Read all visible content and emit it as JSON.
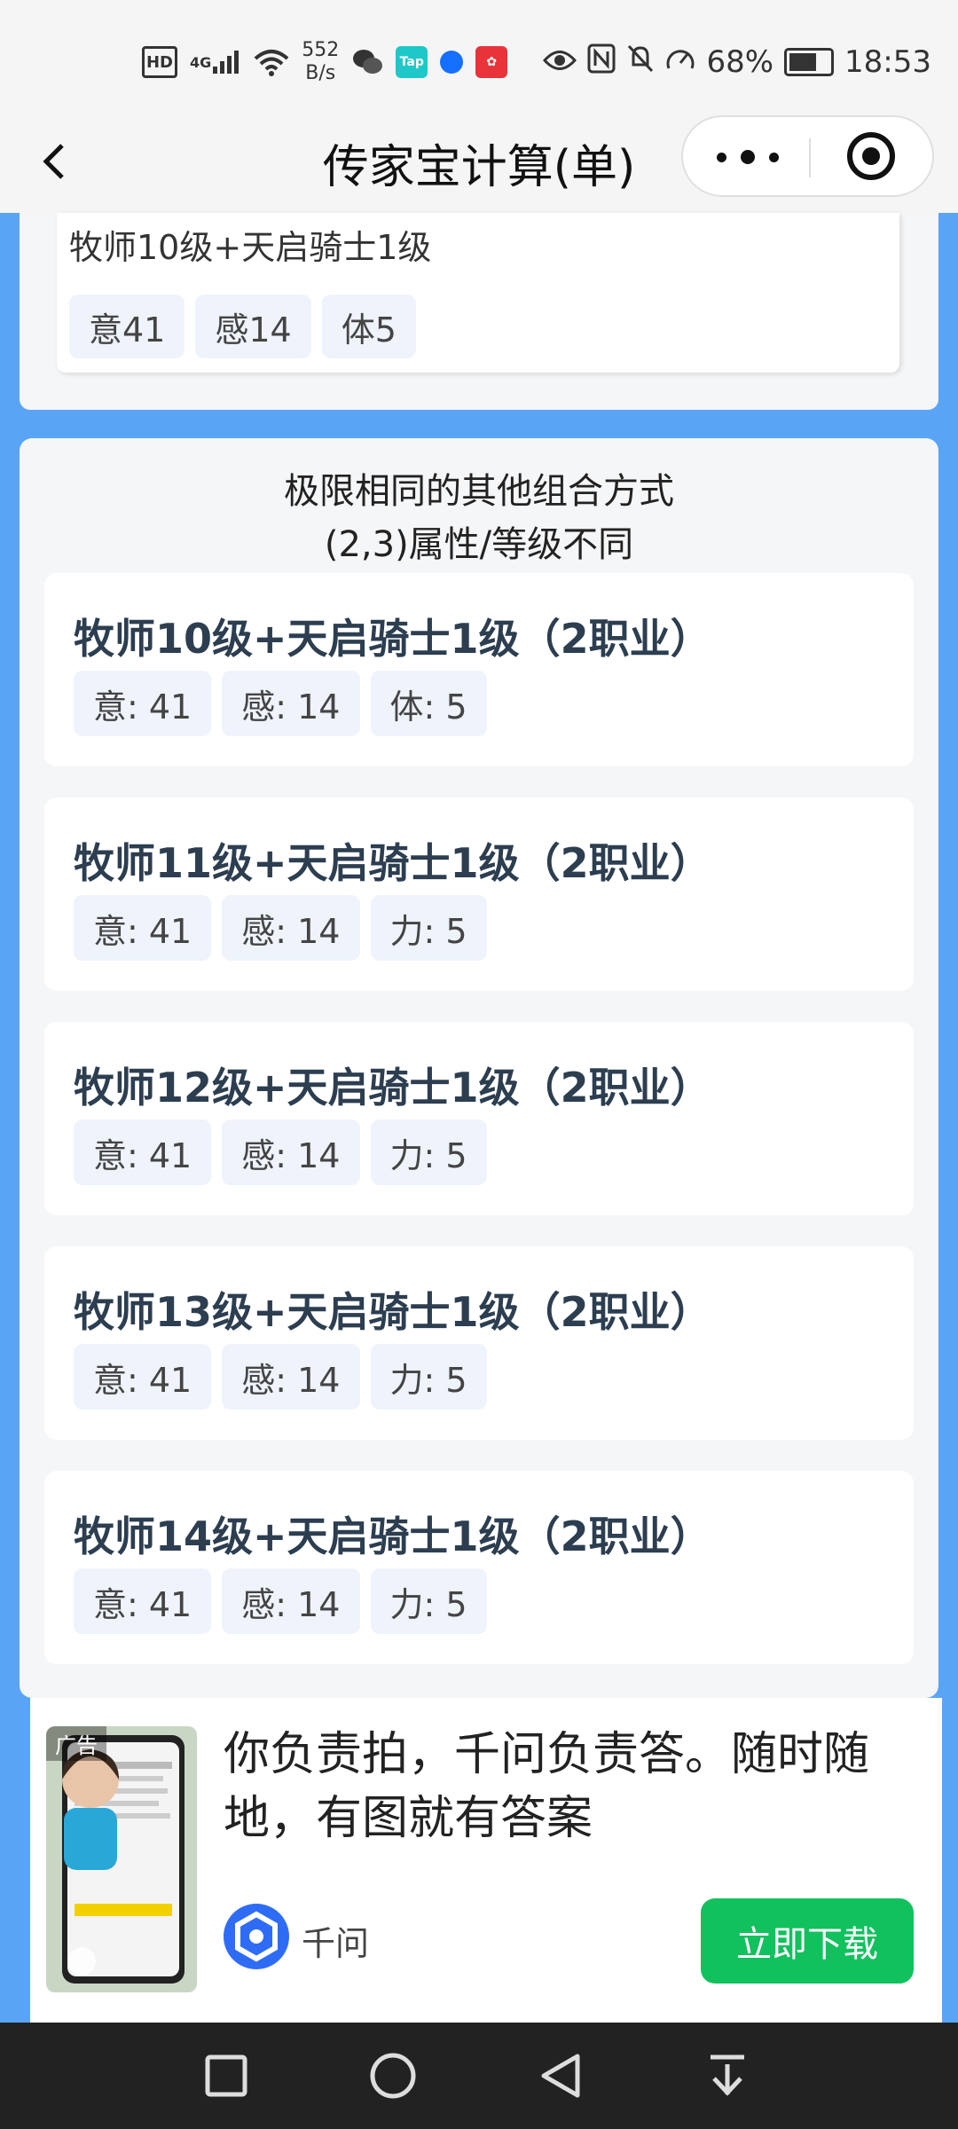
{
  "status": {
    "network": "4G",
    "speed_value": "552",
    "speed_unit": "B/s",
    "tap_label": "Tap",
    "battery": "68%",
    "battery_level": 0.68,
    "time": "18:53"
  },
  "header": {
    "title": "传家宝计算(单)"
  },
  "top_card": {
    "title": "牧师10级+天启骑士1级",
    "tags": [
      "意41",
      "感14",
      "体5"
    ]
  },
  "combos": {
    "heading_line1": "极限相同的其他组合方式",
    "heading_line2": "(2,3)属性/等级不同",
    "items": [
      {
        "title": "牧师10级+天启骑士1级（2职业）",
        "tags": [
          "意: 41",
          "感: 14",
          "体: 5"
        ]
      },
      {
        "title": "牧师11级+天启骑士1级（2职业）",
        "tags": [
          "意: 41",
          "感: 14",
          "力: 5"
        ]
      },
      {
        "title": "牧师12级+天启骑士1级（2职业）",
        "tags": [
          "意: 41",
          "感: 14",
          "力: 5"
        ]
      },
      {
        "title": "牧师13级+天启骑士1级（2职业）",
        "tags": [
          "意: 41",
          "感: 14",
          "力: 5"
        ]
      },
      {
        "title": "牧师14级+天启骑士1级（2职业）",
        "tags": [
          "意: 41",
          "感: 14",
          "力: 5"
        ]
      }
    ]
  },
  "ad": {
    "badge": "广告",
    "text": "你负责拍，千问负责答。随时随地，有图就有答案",
    "brand": "千问",
    "cta": "立即下载"
  },
  "colors": {
    "accent_blue": "#5aa4f5",
    "cta_green": "#11c15e"
  }
}
